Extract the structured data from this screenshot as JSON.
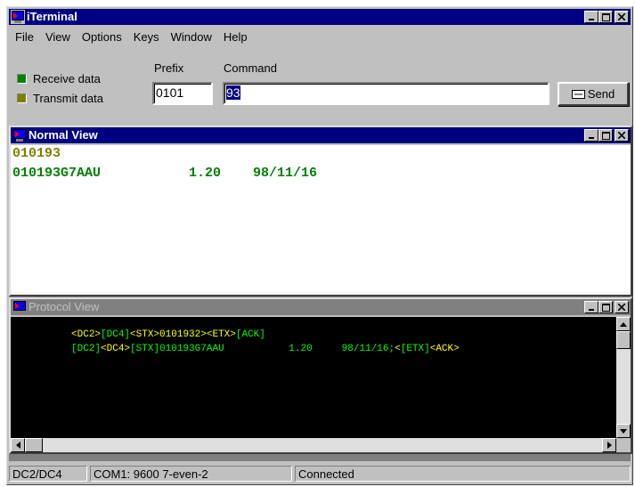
{
  "window": {
    "title": "iTerminal"
  },
  "menu": [
    "File",
    "View",
    "Options",
    "Keys",
    "Window",
    "Help"
  ],
  "indicators": {
    "receive_label": "Receive data",
    "transmit_label": "Transmit data",
    "receive_color": "#008000",
    "transmit_color": "#808000"
  },
  "prefix": {
    "label": "Prefix",
    "value": "0101"
  },
  "command": {
    "label": "Command",
    "value": "93"
  },
  "send_button": {
    "label": "Send"
  },
  "normal_view": {
    "title": "Normal View",
    "lines": [
      {
        "text": "010193",
        "color": "#808000"
      },
      {
        "text": "010193G7AAU           1.20    98/11/16",
        "color": "#008000"
      }
    ]
  },
  "protocol_view": {
    "title": "Protocol View",
    "lines": [
      [
        {
          "text": "<DC2>",
          "color": "#ffff00"
        },
        {
          "text": "[DC4]",
          "color": "#00ff00"
        },
        {
          "text": "<STX>0101932><ETX>",
          "color": "#ffff00"
        },
        {
          "text": "[ACK]",
          "color": "#00ff00"
        }
      ],
      [
        {
          "text": "[DC2]",
          "color": "#00ff00"
        },
        {
          "text": "<DC4>",
          "color": "#ffff00"
        },
        {
          "text": "[STX]010193G7AAU           1.20     98/11/16;",
          "color": "#00ff00"
        },
        {
          "text": "<",
          "color": "#ffff00"
        },
        {
          "text": "[ETX]",
          "color": "#00ff00"
        },
        {
          "text": "<ACK>",
          "color": "#ffff00"
        }
      ]
    ]
  },
  "status_bar": [
    "DC2/DC4",
    "COM1: 9600 7-even-2",
    "Connected"
  ]
}
